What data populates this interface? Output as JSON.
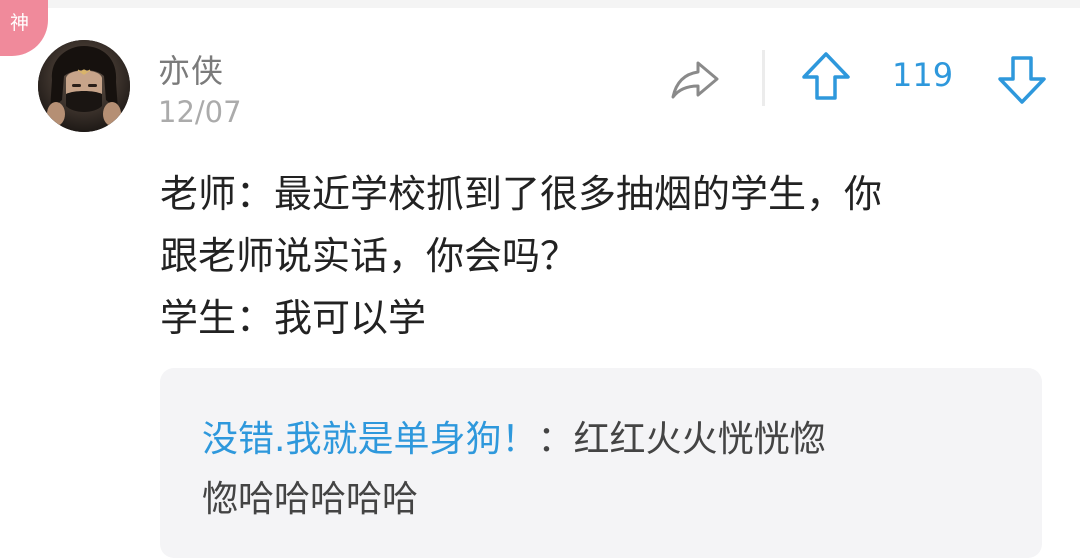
{
  "badge": {
    "label": "神",
    "color": "#f08a9b"
  },
  "comment": {
    "username": "亦侠",
    "date": "12/07",
    "avatar_icon": "avatar-icon",
    "vote_count": "119",
    "content_lines": [
      "老师：最近学校抓到了很多抽烟的学生，你",
      "跟老师说实话，你会吗？",
      "学生：我可以学"
    ]
  },
  "actions": {
    "share_icon": "share-icon",
    "upvote_icon": "upvote-icon",
    "downvote_icon": "downvote-icon"
  },
  "reply": {
    "author": "没错.我就是单身狗！",
    "separator": "：",
    "text_line1": "红红火火恍恍惚",
    "text_line2": "惚哈哈哈哈哈"
  },
  "colors": {
    "accent": "#2e98dc",
    "username": "#7b7b7b",
    "date": "#ababab",
    "text": "#222222",
    "reply_bg": "#f4f4f6"
  }
}
